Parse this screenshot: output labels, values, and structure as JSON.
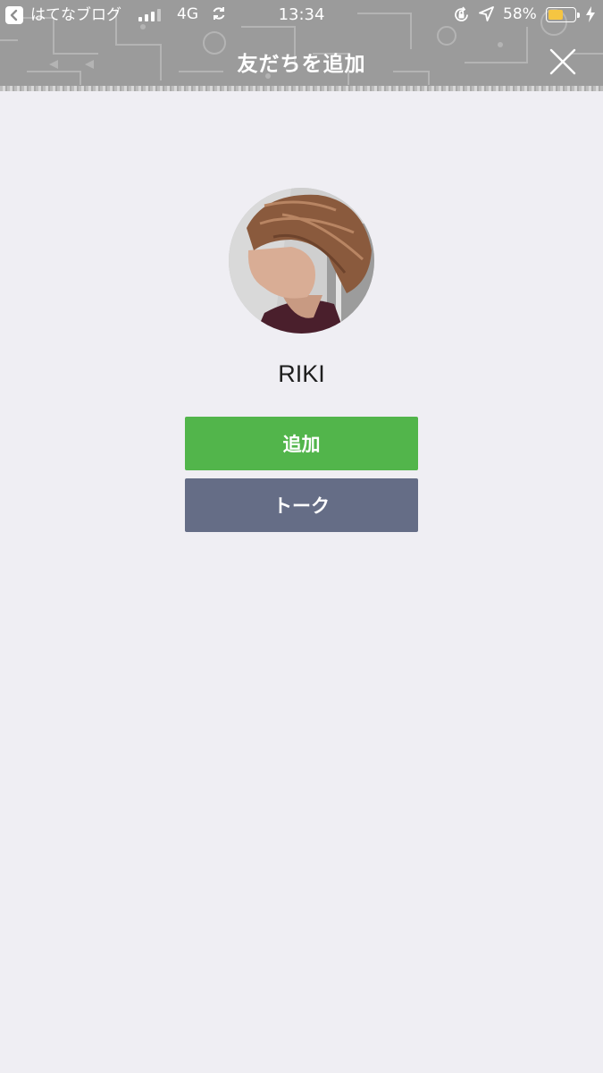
{
  "status_bar": {
    "back_app_label": "はてなブログ",
    "network": "4G",
    "time": "13:34",
    "battery_percent": "58%",
    "battery_level": 0.58,
    "battery_color": "#f5c542"
  },
  "header": {
    "title": "友だちを追加",
    "close_icon": "close-icon"
  },
  "profile": {
    "name": "RIKI"
  },
  "actions": {
    "add_label": "追加",
    "add_color": "#52b54b",
    "talk_label": "トーク",
    "talk_color": "#656d86"
  }
}
